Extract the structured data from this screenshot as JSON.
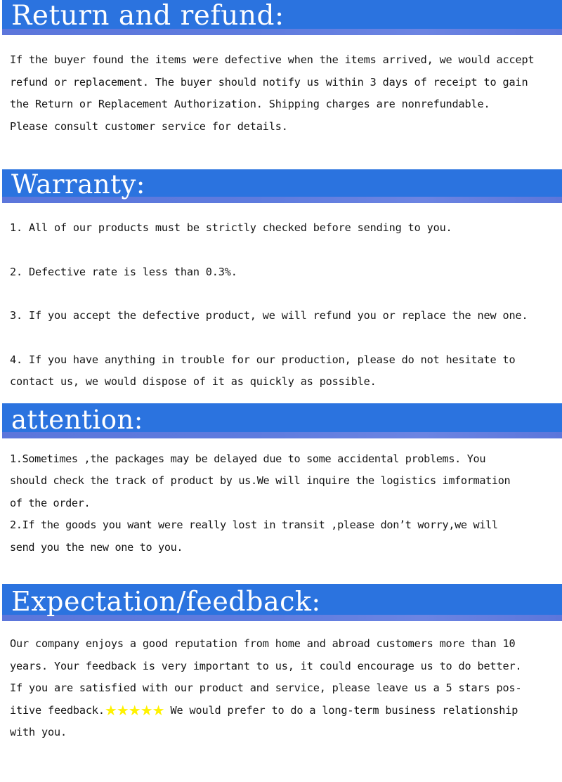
{
  "theme": {
    "banner_blue": "#2B73DF",
    "banner_strip": "#5E7BDE",
    "star_yellow": "#FFF200",
    "text_color": "#141414",
    "page_background": "#FFFFFF"
  },
  "sections": [
    {
      "id": "return-and-refund",
      "title": "Return and refund:",
      "lines": [
        "If the buyer found the items were defective when the items arrived, we would accept",
        "refund or replacement. The buyer should notify us within 3 days of receipt to gain",
        "the Return or Replacement Authorization. Shipping charges are nonrefundable.",
        "Please consult customer service for details."
      ]
    },
    {
      "id": "warranty",
      "title": "Warranty:",
      "items": [
        {
          "lines": [
            "1. All of our products must be strictly checked before sending to you."
          ]
        },
        {
          "lines": [
            "2. Defective rate is less than 0.3%."
          ]
        },
        {
          "lines": [
            "3. If you accept the defective product, we will refund you or replace the new one."
          ]
        },
        {
          "lines": [
            "4. If you have anything in trouble for our production, please do not hesitate to",
            "contact us, we would dispose of it as quickly as possible."
          ]
        }
      ]
    },
    {
      "id": "attention",
      "title": "attention:",
      "items": [
        {
          "lines": [
            "1.Sometimes ,the packages may be delayed due to some accidental problems. You",
            "should check the track of product by us.We will inquire the logistics imformation",
            "of the order."
          ]
        },
        {
          "lines": [
            "2.If the goods you want were really lost in transit ,please don’t worry,we will",
            "send you the new one to you."
          ]
        }
      ]
    },
    {
      "id": "expectation-feedback",
      "title": "Expectation/feedback:",
      "lines_before_stars": [
        "Our company enjoys a good reputation from home and abroad customers more than 10",
        "years. Your feedback is very important to us, it could encourage us to do better.",
        "If you are satisfied with our product and service, please leave us a 5 stars pos-"
      ],
      "star_line_prefix": "itive feedback.",
      "stars": "★★★★★",
      "star_count": 5,
      "star_line_suffix": " We would prefer to do a long-term business relationship",
      "lines_after_stars": [
        "with you."
      ]
    }
  ]
}
